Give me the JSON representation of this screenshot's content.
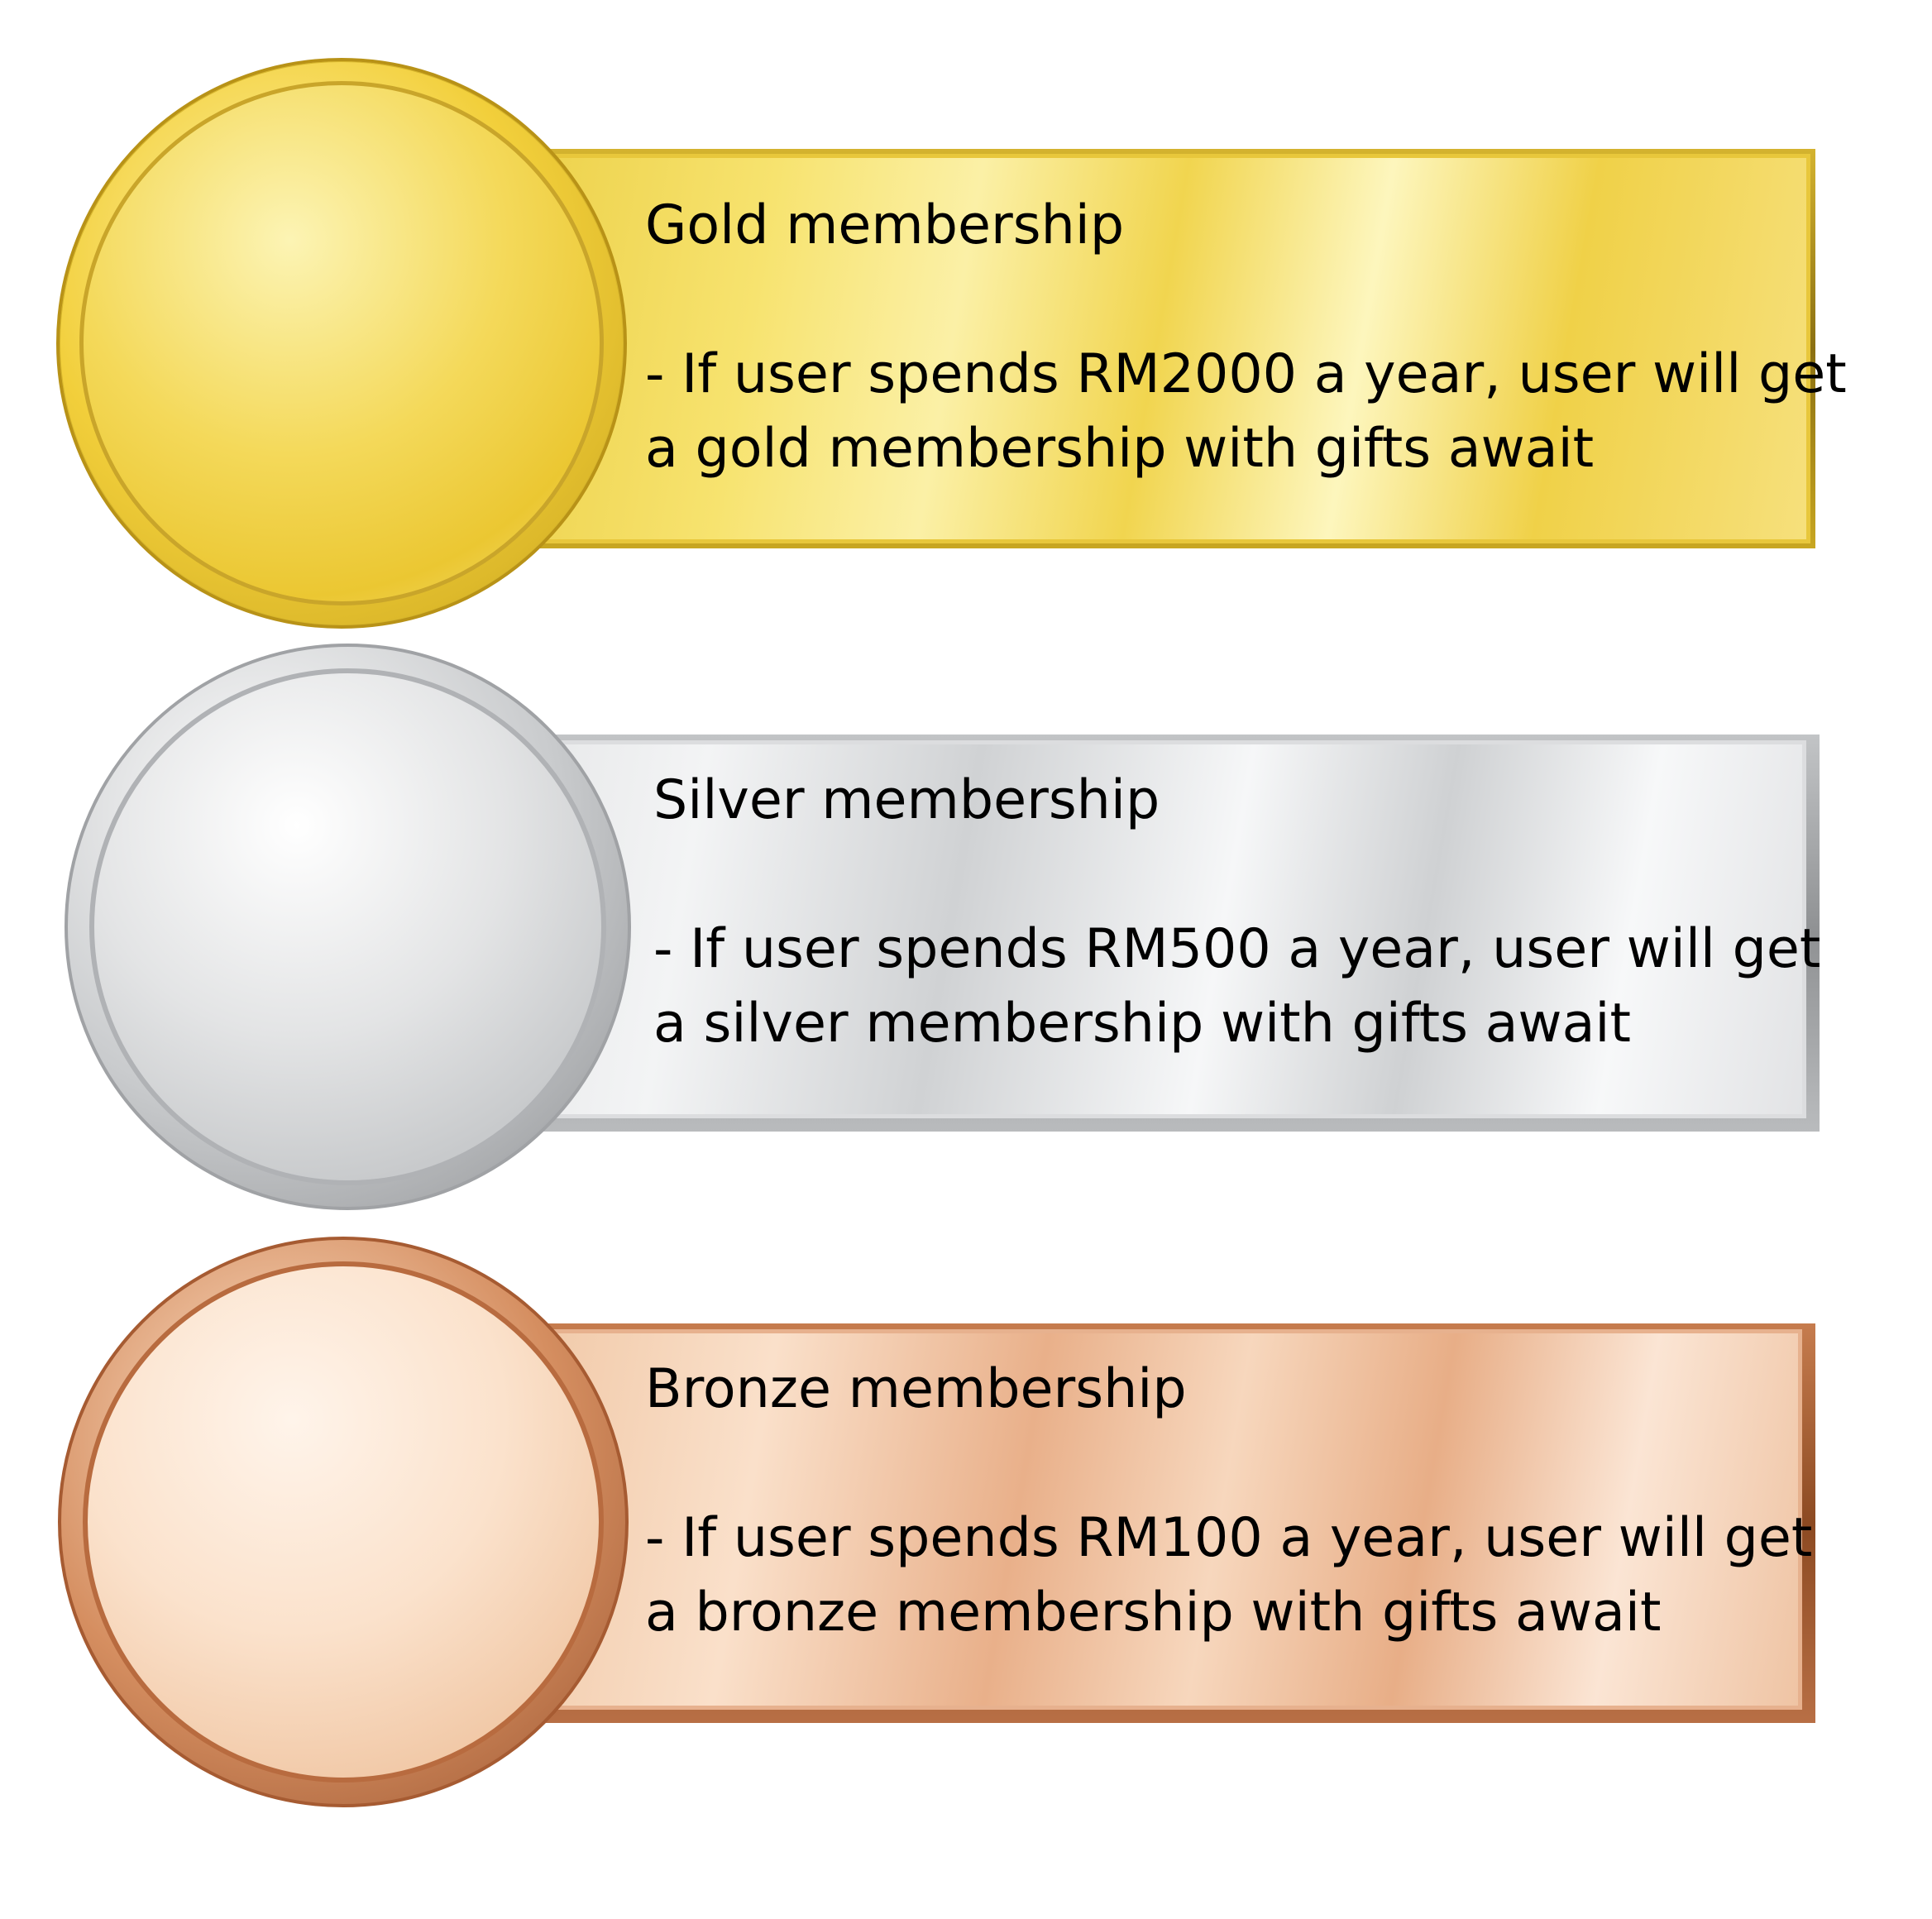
{
  "tiers": [
    {
      "title": "Gold membership",
      "description_lines": [
        "- If user spends RM2000 a year, user will get",
        "a gold membership with gifts await"
      ]
    },
    {
      "title": "Silver membership",
      "description_lines": [
        "- If user spends RM500 a year, user will get",
        "a silver membership with gifts await"
      ]
    },
    {
      "title": "Bronze membership",
      "description_lines": [
        "- If user spends RM100 a year, user will get",
        "a bronze membership with gifts await"
      ]
    }
  ],
  "colors": {
    "gold": "#f2cf3b",
    "silver": "#c9cbcd",
    "bronze": "#d58e60",
    "text": "#000000",
    "background": "#ffffff"
  }
}
